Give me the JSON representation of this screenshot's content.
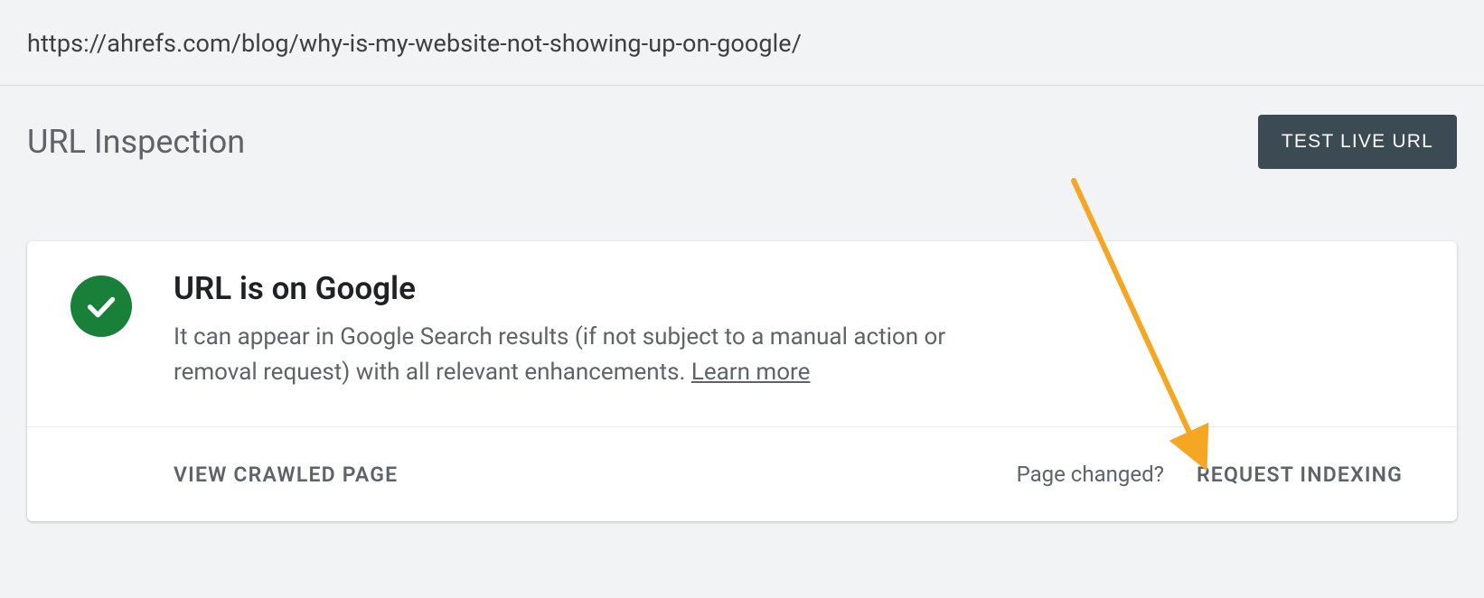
{
  "url_bar": {
    "url": "https://ahrefs.com/blog/why-is-my-website-not-showing-up-on-google/"
  },
  "header": {
    "title": "URL Inspection",
    "test_live_label": "TEST LIVE URL"
  },
  "card": {
    "status_icon": "checkmark-circle-green",
    "status_color": "#188038",
    "title": "URL is on Google",
    "description": "It can appear in Google Search results (if not subject to a manual action or removal request) with all relevant enhancements. ",
    "learn_more_label": "Learn more",
    "view_crawled_label": "VIEW CRAWLED PAGE",
    "page_changed_label": "Page changed?",
    "request_indexing_label": "REQUEST INDEXING"
  },
  "annotation": {
    "arrow_color": "#f5a623"
  }
}
